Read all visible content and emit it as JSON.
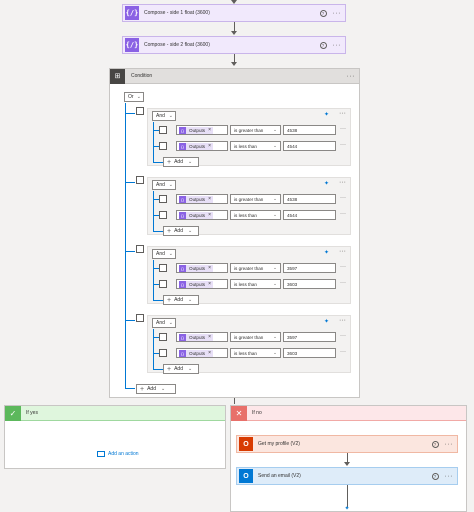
{
  "top_actions": [
    {
      "title": "Compose - side 1 float (3600)",
      "icon": "compose-icon"
    },
    {
      "title": "Compose - side 2 float (3600)",
      "icon": "compose-icon"
    }
  ],
  "condition": {
    "title": "Condition",
    "root_operator": "Or",
    "groups": [
      {
        "operator": "And",
        "rows": [
          {
            "token": "Outputs",
            "op": "is greater than",
            "value": "4538"
          },
          {
            "token": "Outputs",
            "op": "is less than",
            "value": "4544"
          }
        ],
        "add_label": "Add"
      },
      {
        "operator": "And",
        "rows": [
          {
            "token": "Outputs",
            "op": "is greater than",
            "value": "4538"
          },
          {
            "token": "Outputs",
            "op": "is less than",
            "value": "4544"
          }
        ],
        "add_label": "Add"
      },
      {
        "operator": "And",
        "rows": [
          {
            "token": "Outputs",
            "op": "is greater than",
            "value": "3597"
          },
          {
            "token": "Outputs",
            "op": "is less than",
            "value": "3603"
          }
        ],
        "add_label": "Add"
      },
      {
        "operator": "And",
        "rows": [
          {
            "token": "Outputs",
            "op": "is greater than",
            "value": "3597"
          },
          {
            "token": "Outputs",
            "op": "is less than",
            "value": "3603"
          }
        ],
        "add_label": "Add"
      }
    ],
    "root_add_label": "Add"
  },
  "branches": {
    "yes": {
      "title": "If yes",
      "add_action_label": "Add an action",
      "color": "#5cb85c"
    },
    "no": {
      "title": "If no",
      "color": "#e8706a",
      "actions": [
        {
          "title": "Get my profile (V2)",
          "icon": "office-icon",
          "color": "#d83b01"
        },
        {
          "title": "Send an email (V2)",
          "icon": "outlook-icon",
          "color": "#0078d4"
        }
      ]
    }
  }
}
